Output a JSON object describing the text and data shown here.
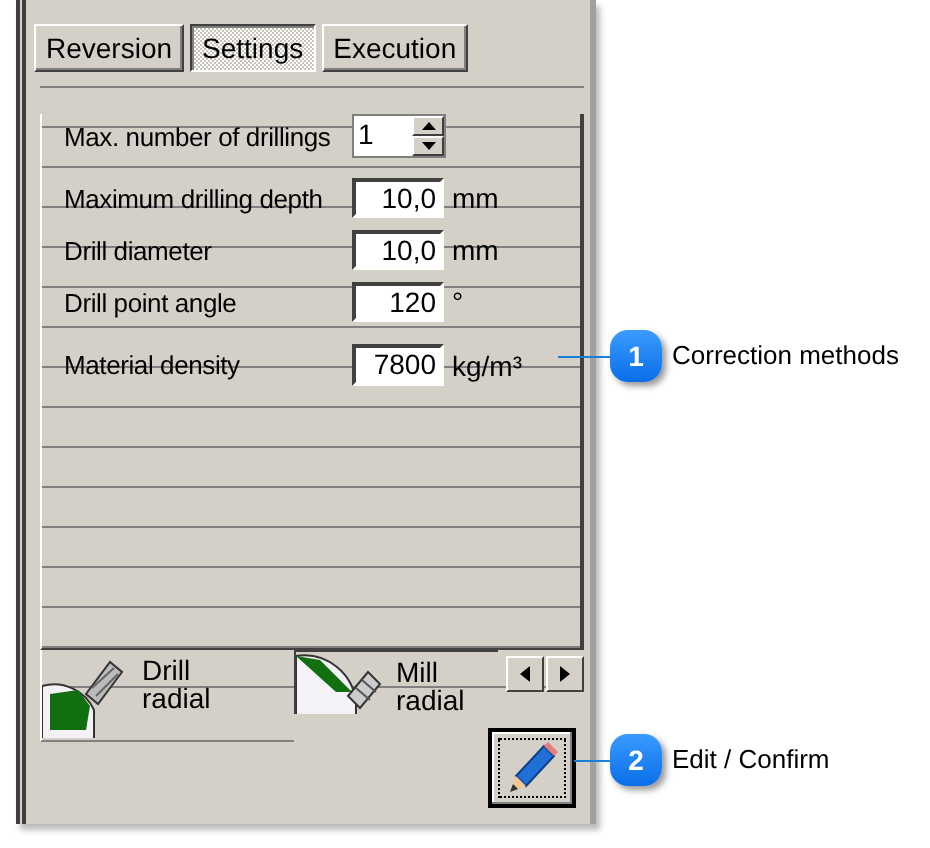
{
  "tabs": [
    {
      "label": "Reversion",
      "selected": false
    },
    {
      "label": "Settings",
      "selected": true
    },
    {
      "label": "Execution",
      "selected": false
    }
  ],
  "fields": [
    {
      "kind": "spin",
      "label": "Max. number of drillings",
      "value": "1"
    },
    {
      "kind": "number",
      "label": "Maximum drilling depth",
      "value": "10,0",
      "unit": "mm"
    },
    {
      "kind": "number",
      "label": "Drill diameter",
      "value": "10,0",
      "unit": "mm"
    },
    {
      "kind": "number",
      "label": "Drill point angle",
      "value": "120",
      "unit": "°"
    },
    {
      "kind": "number",
      "label": "Material density",
      "value": "7800",
      "unit": "kg/m³"
    }
  ],
  "tool_tabs": [
    {
      "kind": "drill",
      "label": "Drill radial",
      "selected": true
    },
    {
      "kind": "mill",
      "label": "Mill radial",
      "selected": false
    }
  ],
  "callouts": [
    {
      "number": "1",
      "text": "Correction methods"
    },
    {
      "number": "2",
      "text": "Edit / Confirm"
    }
  ]
}
